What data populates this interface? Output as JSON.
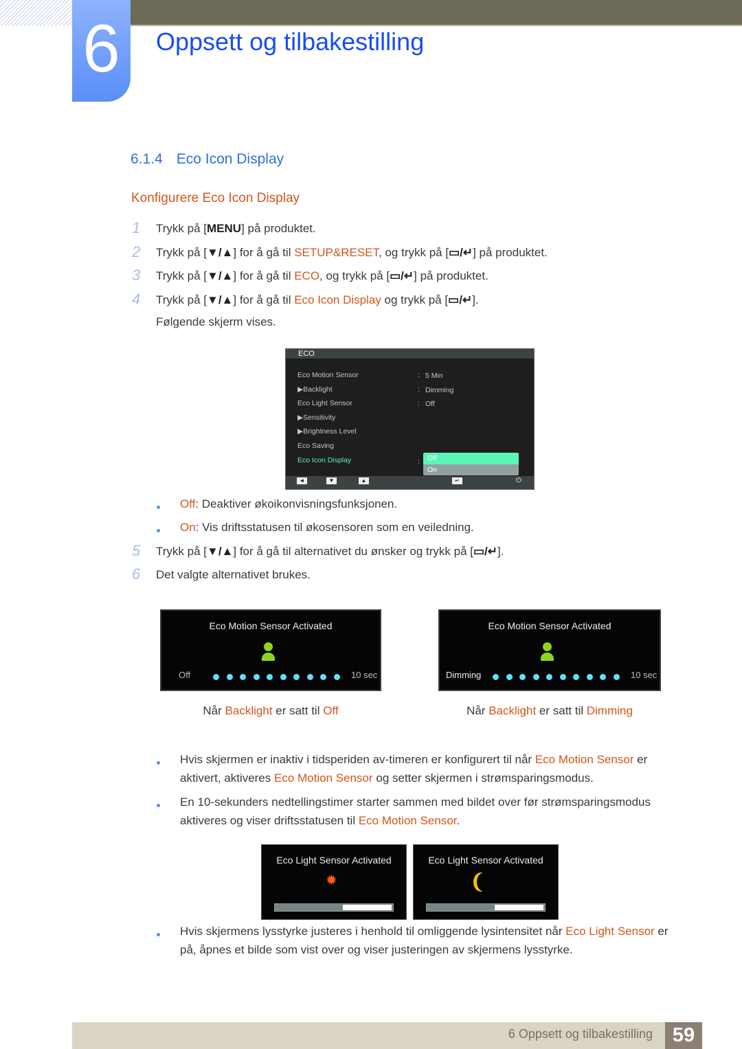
{
  "chapter": {
    "number": "6",
    "title": "Oppsett og tilbakestilling"
  },
  "section": {
    "number": "6.1.4",
    "title": "Eco Icon Display"
  },
  "subheading": "Konfigurere Eco Icon Display",
  "steps": [
    {
      "n": "1",
      "s": [
        "Trykk på [",
        "MENU",
        "] på produktet."
      ]
    },
    {
      "n": "2",
      "s": [
        "Trykk på [",
        "▼/▲",
        "] for å gå til ",
        "SETUP&RESET",
        ", og trykk på [",
        "▭/↵",
        "] på produktet."
      ]
    },
    {
      "n": "3",
      "s": [
        "Trykk på [",
        "▼/▲",
        "] for å gå til ",
        "ECO",
        ", og trykk på [",
        "▭/↵",
        "] på produktet."
      ]
    },
    {
      "n": "4",
      "s": [
        "Trykk på [",
        "▼/▲",
        "] for å gå til ",
        "Eco Icon Display",
        " og trykk på [",
        "▭/↵",
        "]."
      ]
    },
    {
      "n": "",
      "s": [
        "Følgende skjerm vises."
      ]
    },
    {
      "n": "5",
      "s": [
        "Trykk på [",
        "▼/▲",
        "] for å gå til alternativet du ønsker og trykk på [",
        "▭/↵",
        "]."
      ]
    },
    {
      "n": "6",
      "s": [
        "Det valgte alternativet brukes."
      ]
    }
  ],
  "osd": {
    "title": "ECO",
    "rows": [
      {
        "label": "Eco Motion Sensor",
        "value": "5 Min"
      },
      {
        "label": "▶Backlight",
        "value": "Dimming"
      },
      {
        "label": "Eco Light Sensor",
        "value": "Off"
      },
      {
        "label": "▶Sensitivity",
        "value": ""
      },
      {
        "label": "▶Brightness Level",
        "value": ""
      },
      {
        "label": "Eco Saving",
        "value": ""
      },
      {
        "label": "Eco Icon Display",
        "value": ""
      }
    ],
    "options": [
      "Off",
      "On"
    ],
    "selected": "Off",
    "separator": ":",
    "buttons": [
      "◄",
      "▼",
      "▲",
      "↵",
      "⏻"
    ],
    "highlight_color": "#5cf5b8"
  },
  "option_bullets": [
    {
      "key": "Off",
      "text": ": Deaktiver økoikonvisningsfunksjonen."
    },
    {
      "key": "On",
      "text": ": Vis driftsstatusen til økosensoren som en veiledning."
    }
  ],
  "motion_screens": [
    {
      "title": "Eco Motion Sensor Activated",
      "left": "Off",
      "right": "10 sec",
      "caption": [
        "Når ",
        "Backlight",
        " er satt til ",
        "Off"
      ]
    },
    {
      "title": "Eco Motion Sensor Activated",
      "left": "Dimming",
      "right": "10 sec",
      "caption": [
        "Når ",
        "Backlight",
        " er satt til ",
        "Dimming"
      ]
    }
  ],
  "notes": [
    {
      "l1": [
        "Hvis skjermen er inaktiv i tidsperiden av-timeren er konfigurert til når ",
        "Eco Motion Sensor",
        " er"
      ],
      "l2": [
        "aktivert, aktiveres ",
        "Eco Motion Sensor",
        " og setter skjermen i strømsparingsmodus."
      ]
    },
    {
      "l1": [
        "En 10-sekunders nedtellingstimer starter sammen med bildet over før strømsparingsmodus"
      ],
      "l2": [
        "aktiveres og viser driftsstatusen til ",
        "Eco Motion Sensor",
        "."
      ]
    },
    {
      "l1": [
        "Hvis skjermens lysstyrke justeres i henhold til omliggende lysintensitet når ",
        "Eco Light Sensor",
        " er"
      ],
      "l2": [
        "på, åpnes et bilde som vist over og viser justeringen av skjermens lysstyrke."
      ]
    }
  ],
  "light_screens": [
    {
      "title": "Eco Light Sensor Activated",
      "icon": "sun-icon",
      "level": 0.58
    },
    {
      "title": "Eco Light Sensor Activated",
      "icon": "moon-icon",
      "level": 0.58
    }
  ],
  "footer": {
    "text": "6 Oppsett og tilbakestilling",
    "page": "59"
  },
  "colors": {
    "accent": "#d4561a",
    "heading": "#1b4cf2",
    "band": "#6d6a58"
  }
}
